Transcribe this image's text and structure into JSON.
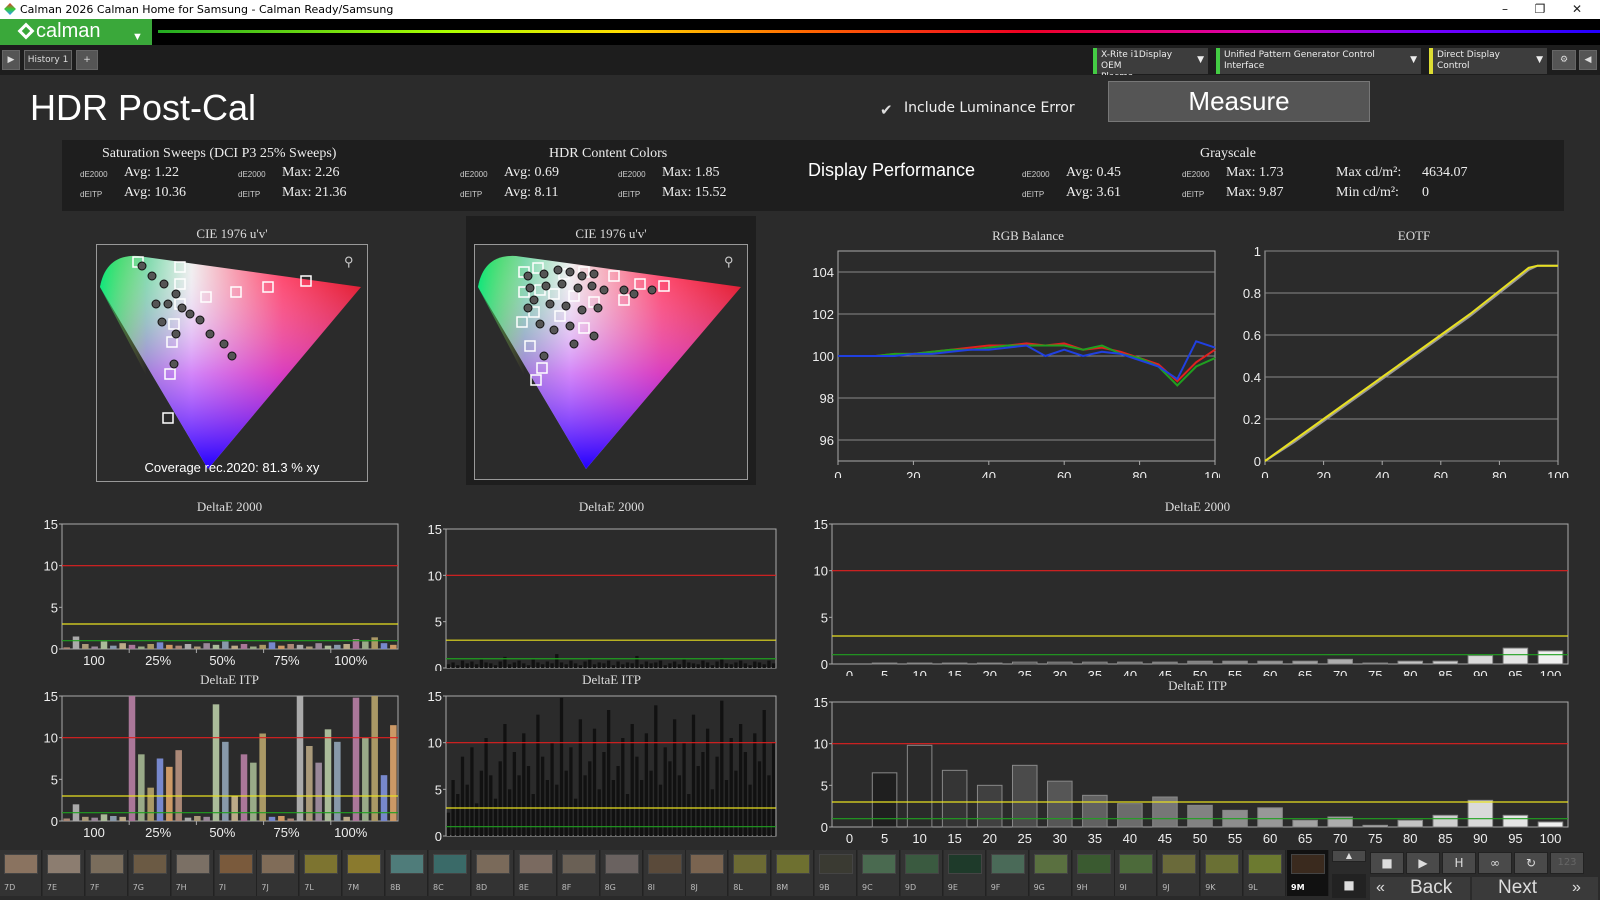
{
  "window": {
    "title": "Calman 2026 Calman Home for Samsung  - Calman Ready/Samsung",
    "min": "–",
    "max": "❐",
    "close": "✕"
  },
  "logo": {
    "text": "calman"
  },
  "tabs": {
    "history": "History 1",
    "plus": "+"
  },
  "devices": [
    {
      "line1": "X-Rite i1Display OEM",
      "line2": "Plasma",
      "color": "#4c4"
    },
    {
      "line1": "Unified Pattern Generator Control Interface",
      "line2": "",
      "color": "#4c4"
    },
    {
      "line1": "Direct Display Control",
      "line2": "",
      "color": "#dd3"
    }
  ],
  "page": {
    "title": "HDR Post-Cal",
    "lum_check": "Include Luminance Error",
    "measure": "Measure"
  },
  "summary": {
    "sat": {
      "title": "Saturation Sweeps (DCI P3 25% Sweeps)",
      "l1": "dE2000",
      "avg1": "Avg: 1.22",
      "l2": "dE2000",
      "max1": "Max: 2.26",
      "l3": "dEITP",
      "avg2": "Avg: 10.36",
      "l4": "dEITP",
      "max2": "Max: 21.36"
    },
    "hdr": {
      "title": "HDR Content Colors",
      "l1": "dE2000",
      "avg1": "Avg: 0.69",
      "l2": "dE2000",
      "max1": "Max: 1.85",
      "l3": "dEITP",
      "avg2": "Avg: 8.11",
      "l4": "dEITP",
      "max2": "Max: 15.52"
    },
    "dp": {
      "title": "Display Performance"
    },
    "gray": {
      "title": "Grayscale",
      "l1": "dE2000",
      "avg1": "Avg: 0.45",
      "l2": "dE2000",
      "max1": "Max: 1.73",
      "l3": "dEITP",
      "avg2": "Avg: 3.61",
      "l4": "dEITP",
      "max2": "Max: 9.87",
      "maxcd": "Max cd/m²:",
      "maxcdv": "4634.07",
      "mincd": "Min cd/m²:",
      "mincdv": "0"
    }
  },
  "panels": {
    "cie1": "CIE 1976 u'v'",
    "cie2": "CIE 1976 u'v'",
    "coverage": "Coverage rec.2020:  81.3 % xy",
    "rgb": "RGB Balance",
    "eotf": "EOTF",
    "de1": "DeltaE 2000",
    "de2": "DeltaE 2000",
    "de3": "DeltaE 2000",
    "itp1": "DeltaE ITP",
    "itp2": "DeltaE ITP",
    "itp3": "DeltaE ITP"
  },
  "colors": {
    "red": "#e02020",
    "yellow": "#e8e020",
    "green": "#20a020"
  },
  "chart_data": [
    {
      "type": "line",
      "title": "RGB Balance",
      "xlim": [
        0,
        100
      ],
      "ylim": [
        95,
        105
      ],
      "xticks": [
        "0",
        "20",
        "40",
        "60",
        "80",
        "100"
      ],
      "yticks": [
        "104",
        "102",
        "100",
        "98",
        "96"
      ],
      "x": [
        0,
        5,
        10,
        15,
        20,
        25,
        30,
        35,
        40,
        45,
        50,
        55,
        60,
        65,
        70,
        75,
        80,
        85,
        90,
        95,
        100
      ],
      "series": [
        {
          "color": "#e02020",
          "values": [
            100,
            100,
            100,
            100.1,
            100.1,
            100.2,
            100.3,
            100.4,
            100.5,
            100.5,
            100.6,
            100.5,
            100.6,
            100.3,
            100.4,
            100.2,
            99.9,
            99.6,
            98.8,
            99.7,
            100.3
          ]
        },
        {
          "color": "#20a020",
          "values": [
            100,
            100,
            100,
            100.1,
            100.1,
            100.2,
            100.3,
            100.3,
            100.4,
            100.5,
            100.5,
            100.5,
            100.5,
            100.3,
            100.5,
            100.1,
            99.9,
            99.5,
            98.6,
            99.5,
            99.9
          ]
        },
        {
          "color": "#2040e0",
          "values": [
            100,
            100,
            100,
            100.0,
            100.1,
            100.1,
            100.2,
            100.3,
            100.3,
            100.4,
            100.5,
            100.0,
            100.3,
            100.0,
            100.2,
            100.1,
            99.8,
            99.5,
            98.9,
            100.7,
            100.4
          ]
        }
      ]
    },
    {
      "type": "line",
      "title": "EOTF",
      "xlim": [
        0,
        100
      ],
      "ylim": [
        0,
        1
      ],
      "xticks": [
        "0",
        "20",
        "40",
        "60",
        "80",
        "100"
      ],
      "yticks": [
        "1",
        "0.8",
        "0.6",
        "0.4",
        "0.2",
        "0"
      ],
      "x": [
        0,
        10,
        20,
        30,
        40,
        50,
        60,
        70,
        80,
        90,
        93,
        100
      ],
      "series": [
        {
          "color": "#999999",
          "values": [
            0,
            0.09,
            0.19,
            0.29,
            0.39,
            0.49,
            0.59,
            0.69,
            0.8,
            0.91,
            0.93,
            0.93
          ]
        },
        {
          "color": "#e8e020",
          "values": [
            0,
            0.1,
            0.2,
            0.3,
            0.4,
            0.5,
            0.6,
            0.7,
            0.81,
            0.92,
            0.93,
            0.93
          ]
        }
      ]
    },
    {
      "type": "bar",
      "title": "DeltaE 2000",
      "ylim": [
        0,
        15
      ],
      "yticks": [
        "15",
        "10",
        "5",
        "0"
      ],
      "xticks": [
        "100",
        "25%",
        "50%",
        "75%",
        "100%"
      ],
      "values": [
        0.2,
        1.5,
        0.6,
        0.3,
        0.9,
        0.4,
        0.7,
        0.5,
        0.3,
        0.6,
        0.8,
        0.5,
        0.4,
        0.6,
        0.3,
        0.7,
        0.5,
        0.9,
        0.4,
        0.6,
        0.3,
        0.5,
        0.8,
        0.4,
        0.6,
        0.5,
        0.3,
        0.7,
        0.4,
        0.5,
        0.6,
        1.2,
        0.9,
        1.4,
        0.7,
        0.5
      ]
    },
    {
      "type": "bar",
      "title": "DeltaE ITP",
      "ylim": [
        0,
        15
      ],
      "yticks": [
        "15",
        "10",
        "5",
        "0"
      ],
      "xticks": [
        "100",
        "25%",
        "50%",
        "75%",
        "100%"
      ],
      "values": [
        0.3,
        2.0,
        0.5,
        0.4,
        0.8,
        0.6,
        0.5,
        15.0,
        8.0,
        4.0,
        7.5,
        6.5,
        8.5,
        0.4,
        0.6,
        0.5,
        14.0,
        9.5,
        3.0,
        8.0,
        7.0,
        10.5,
        0.5,
        0.6,
        0.3,
        15.0,
        9.0,
        7.0,
        11.0,
        9.5,
        0.5,
        14.8,
        10.0,
        15.0,
        5.5,
        11.5
      ]
    },
    {
      "type": "bar",
      "title": "DeltaE 2000",
      "ylim": [
        0,
        15
      ],
      "yticks": [
        "15",
        "10",
        "5",
        "0"
      ],
      "values": [
        0.4,
        0.6,
        0.3,
        0.8,
        0.5,
        0.7,
        0.4,
        0.9,
        0.6,
        0.5,
        0.3,
        0.7,
        1.2,
        0.4,
        0.6,
        0.8,
        0.5,
        0.3,
        0.9,
        0.6,
        0.4,
        0.7,
        0.5,
        1.5,
        0.6,
        0.4,
        0.8,
        0.5,
        0.3,
        0.7,
        0.9,
        0.4,
        0.6,
        0.5,
        0.8,
        0.3,
        0.7,
        0.4,
        0.6,
        0.5,
        1.3,
        0.4,
        0.7,
        0.5,
        0.6,
        0.8,
        0.3,
        0.5,
        0.7,
        0.4,
        0.9,
        0.6,
        0.5,
        0.4,
        0.8,
        0.6,
        0.3,
        0.7,
        1.0,
        0.5,
        0.4,
        0.6,
        0.8,
        0.5,
        0.3,
        0.7,
        0.6,
        0.4,
        0.8,
        0.5
      ]
    },
    {
      "type": "bar",
      "title": "DeltaE ITP",
      "ylim": [
        0,
        15
      ],
      "yticks": [
        "15",
        "10",
        "5",
        "0"
      ],
      "values": [
        2.5,
        6.0,
        4.5,
        8.5,
        5.5,
        9.5,
        3.5,
        7.0,
        10.5,
        6.5,
        4.0,
        8.0,
        12.0,
        5.0,
        9.0,
        6.5,
        11.0,
        7.5,
        4.5,
        13.0,
        8.5,
        6.0,
        10.0,
        5.5,
        14.8,
        7.0,
        9.5,
        4.0,
        12.5,
        6.5,
        8.0,
        11.5,
        5.0,
        9.0,
        13.5,
        6.0,
        7.5,
        10.5,
        4.5,
        12.0,
        8.5,
        6.0,
        11.0,
        7.0,
        14.0,
        5.5,
        9.5,
        8.0,
        12.5,
        6.5,
        10.0,
        4.5,
        13.0,
        7.5,
        9.0,
        11.5,
        5.0,
        8.5,
        14.5,
        6.0,
        10.5,
        7.0,
        12.0,
        9.0,
        5.5,
        11.0,
        8.0,
        13.5,
        6.5,
        10.0
      ]
    },
    {
      "type": "bar",
      "title": "DeltaE 2000",
      "ylim": [
        0,
        15
      ],
      "yticks": [
        "15",
        "10",
        "5",
        "0"
      ],
      "xticks": [
        "0",
        "5",
        "10",
        "15",
        "20",
        "25",
        "30",
        "35",
        "40",
        "45",
        "50",
        "55",
        "60",
        "65",
        "70",
        "75",
        "80",
        "85",
        "90",
        "95",
        "100"
      ],
      "values": [
        0,
        0.1,
        0.1,
        0.1,
        0.1,
        0.2,
        0.2,
        0.2,
        0.2,
        0.2,
        0.3,
        0.3,
        0.3,
        0.3,
        0.5,
        0.1,
        0.3,
        0.3,
        0.9,
        1.7,
        1.4
      ]
    },
    {
      "type": "bar",
      "title": "DeltaE ITP",
      "ylim": [
        0,
        15
      ],
      "yticks": [
        "15",
        "10",
        "5",
        "0"
      ],
      "xticks": [
        "0",
        "5",
        "10",
        "15",
        "20",
        "25",
        "30",
        "35",
        "40",
        "45",
        "50",
        "55",
        "60",
        "65",
        "70",
        "75",
        "80",
        "85",
        "90",
        "95",
        "100"
      ],
      "values": [
        0,
        6.5,
        9.8,
        6.8,
        5.0,
        7.4,
        5.5,
        3.8,
        2.8,
        3.6,
        2.6,
        2.0,
        2.3,
        0.8,
        1.2,
        0.2,
        0.8,
        1.4,
        3.2,
        1.4,
        0.6
      ]
    }
  ],
  "swatches": [
    {
      "label": "7D",
      "color": "#8a7360"
    },
    {
      "label": "7E",
      "color": "#8c7d70"
    },
    {
      "label": "7F",
      "color": "#7a6d5c"
    },
    {
      "label": "7G",
      "color": "#6b5a44"
    },
    {
      "label": "7H",
      "color": "#7b7065"
    },
    {
      "label": "7I",
      "color": "#7a5a3c"
    },
    {
      "label": "7J",
      "color": "#806c58"
    },
    {
      "label": "7L",
      "color": "#7d7430"
    },
    {
      "label": "7M",
      "color": "#8a7a2e"
    },
    {
      "label": "8B",
      "color": "#4f7c7a"
    },
    {
      "label": "8C",
      "color": "#3a6a68"
    },
    {
      "label": "8D",
      "color": "#7a6a5a"
    },
    {
      "label": "8E",
      "color": "#7a6a60"
    },
    {
      "label": "8F",
      "color": "#6a6055"
    },
    {
      "label": "8G",
      "color": "#6a6260"
    },
    {
      "label": "8I",
      "color": "#5a4a3a"
    },
    {
      "label": "8J",
      "color": "#7a6450"
    },
    {
      "label": "8L",
      "color": "#6c6a34"
    },
    {
      "label": "8M",
      "color": "#6e7030"
    },
    {
      "label": "9B",
      "color": "#3a3a32"
    },
    {
      "label": "9C",
      "color": "#4a6a50"
    },
    {
      "label": "9D",
      "color": "#3a5a40"
    },
    {
      "label": "9E",
      "color": "#1e3a2a"
    },
    {
      "label": "9F",
      "color": "#4a6a58"
    },
    {
      "label": "9G",
      "color": "#5a7040"
    },
    {
      "label": "9H",
      "color": "#3a5a30"
    },
    {
      "label": "9I",
      "color": "#4c6a3a"
    },
    {
      "label": "9J",
      "color": "#6a6a3a"
    },
    {
      "label": "9K",
      "color": "#6a7034"
    },
    {
      "label": "9L",
      "color": "#6c7a30"
    },
    {
      "label": "9M",
      "color": "#3a2a1e"
    }
  ],
  "controls": {
    "stop": "■",
    "play": "▶",
    "save": "H",
    "loop": "∞",
    "refresh": "↻",
    "badge": "123",
    "back": "Back",
    "next": "Next",
    "backarrow": "«",
    "nextarrow": "»"
  }
}
